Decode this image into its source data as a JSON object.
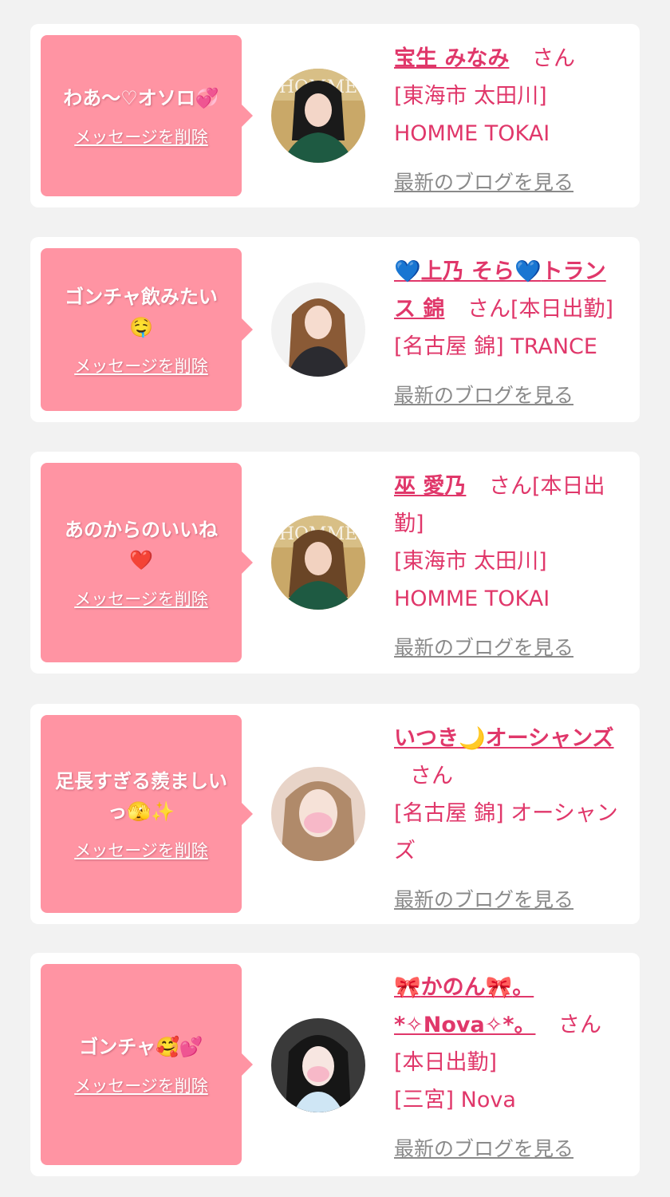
{
  "delete_label": "メッセージを削除",
  "blog_label": "最新のブログを見る",
  "honorific": "さん",
  "colors": {
    "page_bg": "#f2f2f2",
    "card_bg": "#ffffff",
    "bubble": "#ff94a3",
    "accent": "#e0376a",
    "blog_link": "#8a8a8a"
  },
  "messages": [
    {
      "text": "わあ〜♡オソロ",
      "emoji": "💞",
      "emoji_icon": "revolving-hearts-icon",
      "name": "宝生 みなみ",
      "name_suffix": "",
      "after_honorific": "",
      "shop": "[東海市 太田川] HOMME TOKAI"
    },
    {
      "text": "ゴンチャ飲みたい",
      "emoji": "🤤",
      "emoji_icon": "drooling-face-icon",
      "name": "上乃 そら",
      "name_emoji": "💙",
      "name_suffix": "トランス 錦",
      "after_honorific": "[本日出勤]",
      "shop": "[名古屋 錦] TRANCE"
    },
    {
      "text": "あのからのいいね",
      "emoji": "❤️",
      "emoji_icon": "red-heart-icon",
      "name": "巫 愛乃",
      "name_suffix": "",
      "after_honorific": "[本日出勤]",
      "shop": "[東海市 太田川] HOMME TOKAI"
    },
    {
      "text": "足長すぎる羨ましいっ",
      "emoji": "🫣✨",
      "emoji_icon": "peeking-face-sparkles-icon",
      "name": "いつき",
      "name_emoji": "🌙",
      "name_suffix": "オーシャンズ",
      "after_honorific": "",
      "shop": "[名古屋 錦] オーシャンズ"
    },
    {
      "text": "ゴンチャ",
      "emoji": "🥰💕",
      "emoji_icon": "smiling-hearts-icon",
      "name": "かのん",
      "name_emoji": "🎀",
      "name_suffix": "。*✧Nova✧*。",
      "after_honorific": "[本日出勤]",
      "shop": "[三宮] Nova"
    }
  ]
}
